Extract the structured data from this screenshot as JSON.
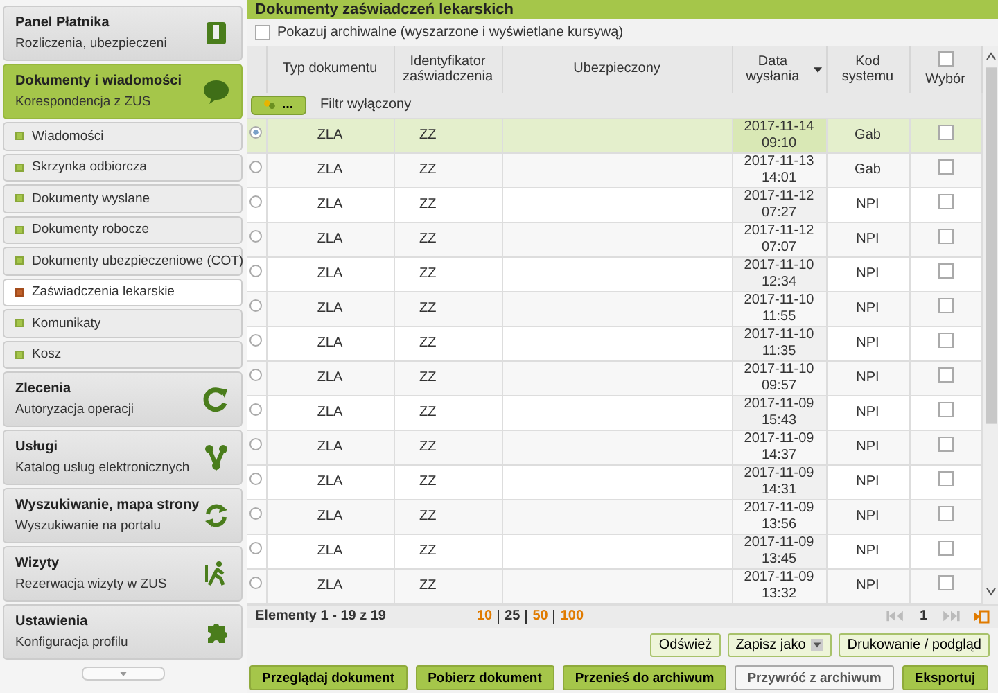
{
  "sidebar": {
    "sections": [
      {
        "title": "Panel Płatnika",
        "subtitle": "Rozliczenia, ubezpieczeni",
        "selected": false
      },
      {
        "title": "Dokumenty i wiadomości",
        "subtitle": "Korespondencja z ZUS",
        "selected": true,
        "items": [
          {
            "label": "Wiadomości",
            "selected": false
          },
          {
            "label": "Skrzynka odbiorcza",
            "selected": false
          },
          {
            "label": "Dokumenty wyslane",
            "selected": false
          },
          {
            "label": "Dokumenty robocze",
            "selected": false
          },
          {
            "label": "Dokumenty ubezpieczeniowe (COT)",
            "selected": false
          },
          {
            "label": "Zaświadczenia lekarskie",
            "selected": true
          },
          {
            "label": "Komunikaty",
            "selected": false
          },
          {
            "label": "Kosz",
            "selected": false
          }
        ]
      },
      {
        "title": "Zlecenia",
        "subtitle": "Autoryzacja operacji",
        "selected": false
      },
      {
        "title": "Usługi",
        "subtitle": "Katalog usług elektronicznych",
        "selected": false
      },
      {
        "title": "Wyszukiwanie, mapa strony",
        "subtitle": "Wyszukiwanie na portalu",
        "selected": false
      },
      {
        "title": "Wizyty",
        "subtitle": "Rezerwacja wizyty w ZUS",
        "selected": false
      },
      {
        "title": "Ustawienia",
        "subtitle": "Konfiguracja profilu",
        "selected": false
      }
    ]
  },
  "panel": {
    "title": "Dokumenty zaświadczeń lekarskich",
    "show_archived": {
      "label": "Pokazuj archiwalne (wyszarzone i wyświetlane kursywą)",
      "checked": false
    },
    "table": {
      "columns": [
        "Typ dokumentu",
        "Identyfikator zaświadczenia",
        "Ubezpieczony",
        "Data wysłania",
        "Kod systemu",
        "Wybór"
      ],
      "select_all_checked": false,
      "filter": {
        "button": "...",
        "label": "Filtr wyłączony"
      },
      "rows": [
        {
          "type": "ZLA",
          "id": "ZZ",
          "sent": "2017-11-14 09:10",
          "system": "Gab",
          "selected": true,
          "checked": false
        },
        {
          "type": "ZLA",
          "id": "ZZ",
          "sent": "2017-11-13 14:01",
          "system": "Gab",
          "selected": false,
          "checked": false
        },
        {
          "type": "ZLA",
          "id": "ZZ",
          "sent": "2017-11-12 07:27",
          "system": "NPI",
          "selected": false,
          "checked": false
        },
        {
          "type": "ZLA",
          "id": "ZZ",
          "sent": "2017-11-12 07:07",
          "system": "NPI",
          "selected": false,
          "checked": false
        },
        {
          "type": "ZLA",
          "id": "ZZ",
          "sent": "2017-11-10 12:34",
          "system": "NPI",
          "selected": false,
          "checked": false
        },
        {
          "type": "ZLA",
          "id": "ZZ",
          "sent": "2017-11-10 11:55",
          "system": "NPI",
          "selected": false,
          "checked": false
        },
        {
          "type": "ZLA",
          "id": "ZZ",
          "sent": "2017-11-10 11:35",
          "system": "NPI",
          "selected": false,
          "checked": false
        },
        {
          "type": "ZLA",
          "id": "ZZ",
          "sent": "2017-11-10 09:57",
          "system": "NPI",
          "selected": false,
          "checked": false
        },
        {
          "type": "ZLA",
          "id": "ZZ",
          "sent": "2017-11-09 15:43",
          "system": "NPI",
          "selected": false,
          "checked": false
        },
        {
          "type": "ZLA",
          "id": "ZZ",
          "sent": "2017-11-09 14:37",
          "system": "NPI",
          "selected": false,
          "checked": false
        },
        {
          "type": "ZLA",
          "id": "ZZ",
          "sent": "2017-11-09 14:31",
          "system": "NPI",
          "selected": false,
          "checked": false
        },
        {
          "type": "ZLA",
          "id": "ZZ",
          "sent": "2017-11-09 13:56",
          "system": "NPI",
          "selected": false,
          "checked": false
        },
        {
          "type": "ZLA",
          "id": "ZZ",
          "sent": "2017-11-09 13:45",
          "system": "NPI",
          "selected": false,
          "checked": false
        },
        {
          "type": "ZLA",
          "id": "ZZ",
          "sent": "2017-11-09 13:32",
          "system": "NPI",
          "selected": false,
          "checked": false
        }
      ]
    },
    "pager": {
      "summary": "Elementy 1 - 19 z 19",
      "page_sizes": [
        {
          "label": "10",
          "selected": false
        },
        {
          "label": "25",
          "selected": true
        },
        {
          "label": "50",
          "selected": false
        },
        {
          "label": "100",
          "selected": false
        }
      ],
      "page": "1"
    },
    "tools": [
      {
        "label": "Odśwież",
        "kind": "plain"
      },
      {
        "label": "Zapisz jako",
        "kind": "dropdown"
      },
      {
        "label": "Drukowanie / podgląd",
        "kind": "plain"
      }
    ],
    "actions": [
      {
        "label": "Przeglądaj dokument",
        "disabled": false
      },
      {
        "label": "Pobierz dokument",
        "disabled": false
      },
      {
        "label": "Przenieś do archiwum",
        "disabled": false
      },
      {
        "label": "Przywróć z archiwum",
        "disabled": true
      },
      {
        "label": "Eksportuj",
        "disabled": false
      }
    ]
  }
}
